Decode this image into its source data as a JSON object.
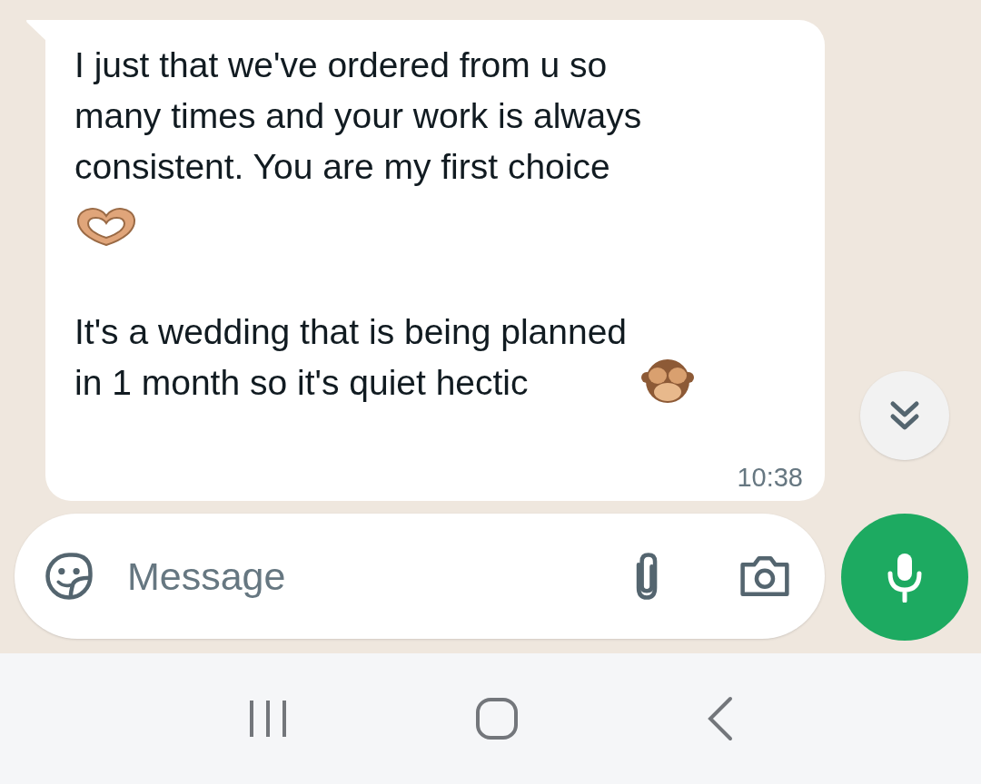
{
  "message": {
    "paragraphs": [
      "I just that we've ordered from u so\nmany times and your work is always\nconsistent. You are my first choice",
      "It's a wedding that is being planned\nin 1 month so it's quiet hectic"
    ],
    "time": "10:38"
  },
  "composer": {
    "placeholder": "Message"
  }
}
